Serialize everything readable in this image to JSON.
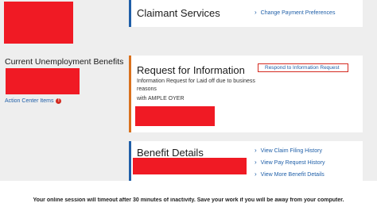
{
  "claimant_services": {
    "title": "Claimant Services",
    "links": [
      {
        "label": "Change Payment Preferences"
      }
    ]
  },
  "sidebar": {
    "title": "Current Unemployment Benefits",
    "action_center_label": "Action Center Items",
    "action_center_badge": "!"
  },
  "request_info": {
    "title": "Request for Information",
    "respond_button": "Respond to Information Request",
    "description": "Information Request for Laid off due to business reasons",
    "with_text": "with AMPLE OYER"
  },
  "benefit_details": {
    "title": "Benefit Details",
    "links": [
      {
        "label": "View Claim Filing History"
      },
      {
        "label": "View Pay Request History"
      },
      {
        "label": "View More Benefit Details"
      }
    ]
  },
  "footer": {
    "notice": "Your online session will timeout after 30 minutes of inactivity. Save your work if you will be away from your computer."
  },
  "colors": {
    "accent_blue": "#1f5fa8",
    "accent_orange": "#d9711e",
    "redaction_red": "#f01a24",
    "page_gray": "#eeeeee"
  }
}
